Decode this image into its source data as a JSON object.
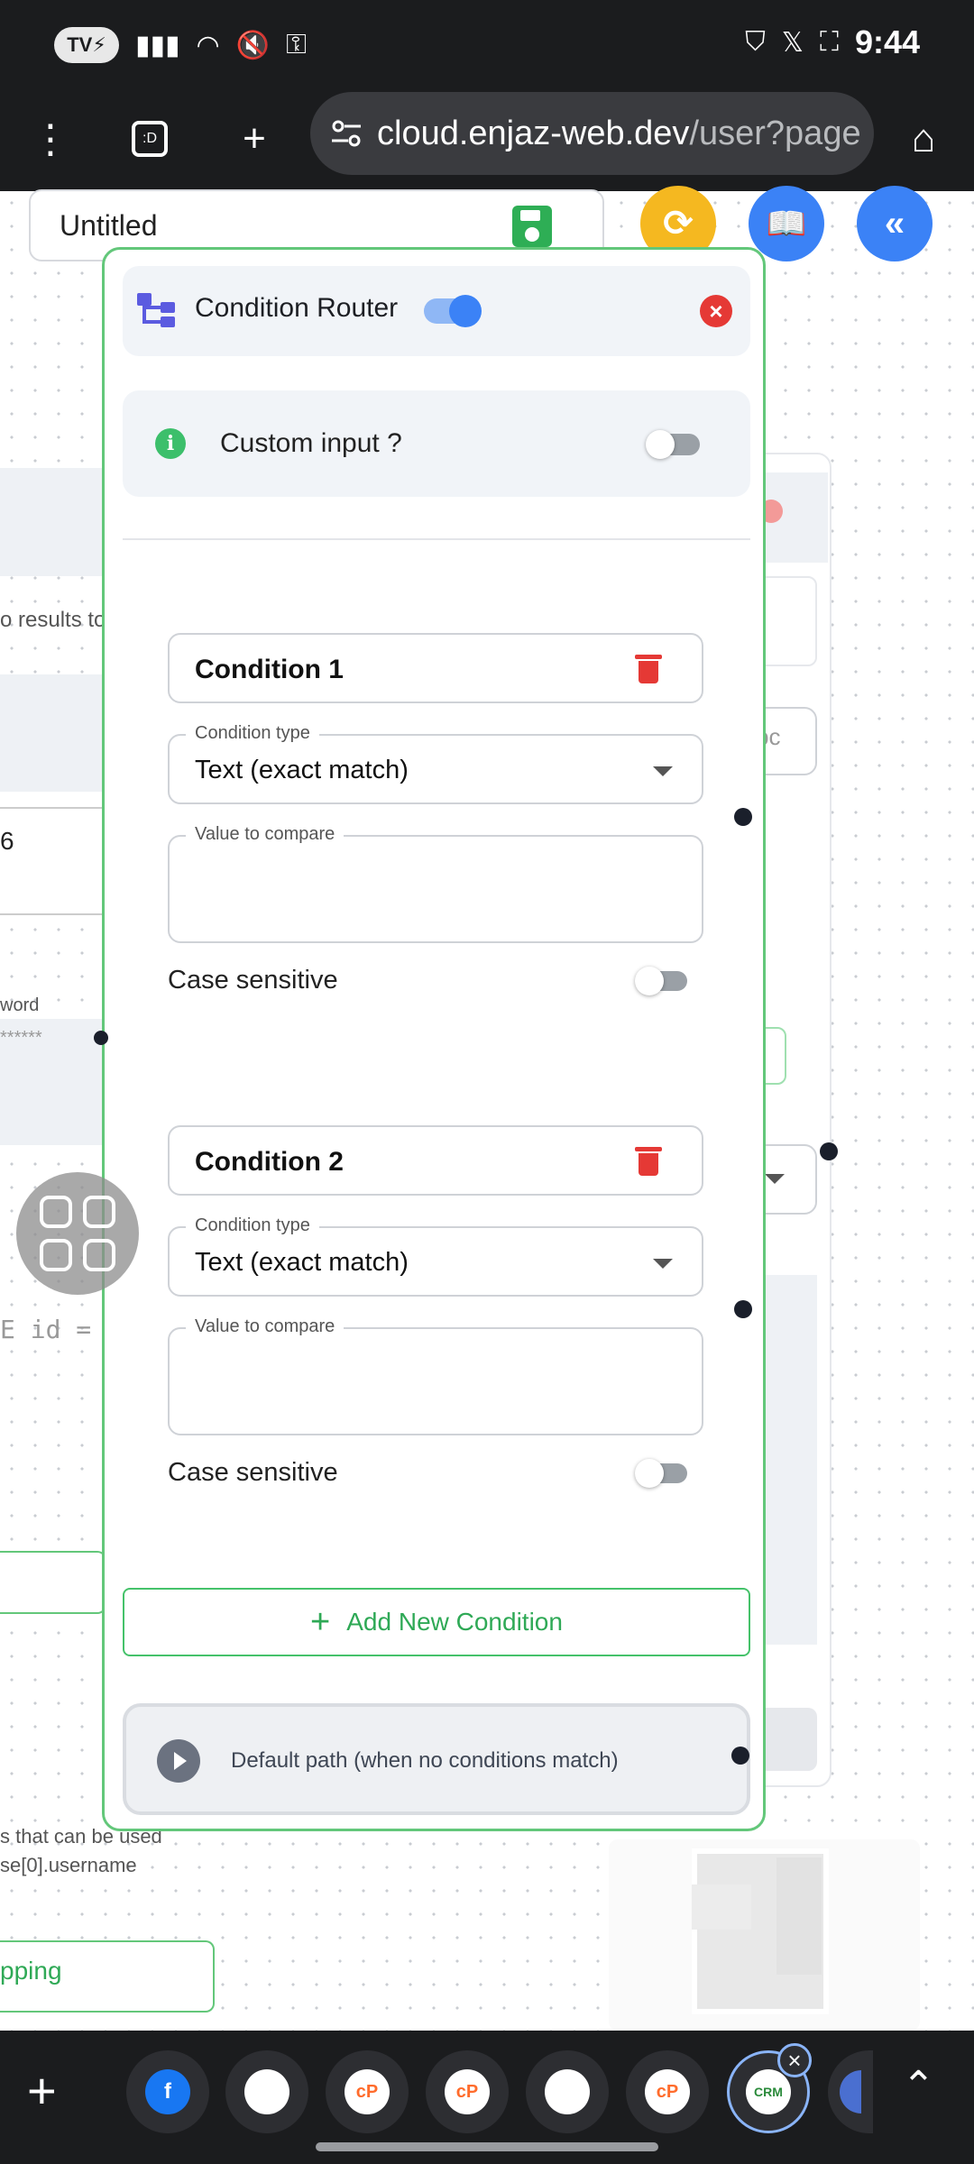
{
  "status_bar": {
    "time": "9:44",
    "pill": "TV"
  },
  "browser": {
    "url_host": "cloud.enjaz-web.dev",
    "url_path": "/user?page"
  },
  "workspace": {
    "title_input": "Untitled",
    "bg_left_texts": [
      "o results to",
      "6",
      "word",
      "******",
      "E id =",
      "s that can be used",
      "se[0].username",
      "pping"
    ],
    "bg_right_texts": [
      "pc"
    ]
  },
  "node": {
    "title": "Condition Router",
    "enabled": true,
    "custom_input_label": "Custom input ?",
    "custom_input_on": false,
    "conditions": [
      {
        "name": "Condition 1",
        "type_label": "Condition type",
        "type_value": "Text (exact match)",
        "compare_label": "Value to compare",
        "compare_value": "",
        "case_label": "Case sensitive",
        "case_on": false
      },
      {
        "name": "Condition 2",
        "type_label": "Condition type",
        "type_value": "Text (exact match)",
        "compare_label": "Value to compare",
        "compare_value": "",
        "case_label": "Case sensitive",
        "case_on": false
      }
    ],
    "add_condition_label": "Add New Condition",
    "default_path_label": "Default path (when no conditions match)"
  },
  "colors": {
    "accent_blue": "#3b82f6",
    "accent_green": "#45c26a",
    "danger_red": "#e53935",
    "refresh_yellow": "#f5b820"
  }
}
